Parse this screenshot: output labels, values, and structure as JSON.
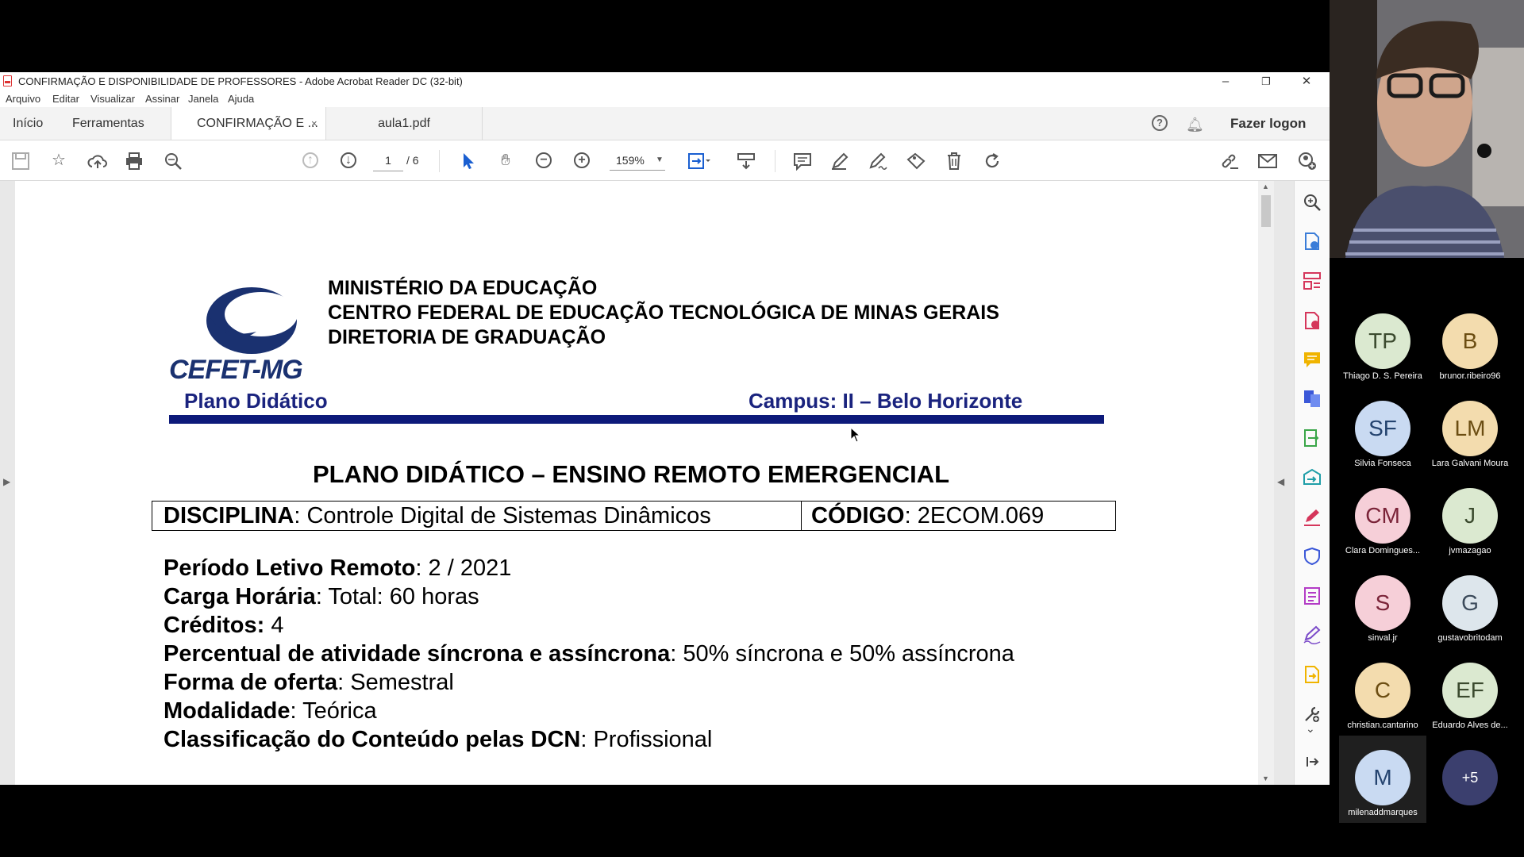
{
  "window": {
    "title": "CONFIRMAÇÃO E DISPONIBILIDADE DE PROFESSORES - Adobe Acrobat Reader DC (32-bit)",
    "controls": {
      "minimize": "–",
      "restore": "❐",
      "close": "✕"
    }
  },
  "menu": [
    "Arquivo",
    "Editar",
    "Visualizar",
    "Assinar",
    "Janela",
    "Ajuda"
  ],
  "tabs": {
    "home": "Início",
    "tools": "Ferramentas",
    "doc1": "CONFIRMAÇÃO E ...",
    "doc1_close": "×",
    "doc2": "aula1.pdf"
  },
  "header_right": {
    "login": "Fazer logon"
  },
  "toolbar": {
    "page_current": "1",
    "page_total": "/ 6",
    "zoom": "159%"
  },
  "document": {
    "ministry_lines": [
      "MINISTÉRIO DA EDUCAÇÃO",
      "CENTRO FEDERAL DE EDUCAÇÃO TECNOLÓGICA DE MINAS GERAIS",
      "DIRETORIA DE GRADUAÇÃO"
    ],
    "logo_text": "CEFET-MG",
    "plano": "Plano Didático",
    "campus": "Campus: II – Belo Horizonte",
    "heading": "PLANO DIDÁTICO – ENSINO REMOTO EMERGENCIAL",
    "disciplina": {
      "label": "DISCIPLINA",
      "value": ": Controle Digital de Sistemas Dinâmicos"
    },
    "codigo": {
      "label": "CÓDIGO",
      "value": ": 2ECOM.069"
    },
    "info": [
      {
        "label": "Período Letivo Remoto",
        "value": ": 2 / 2021"
      },
      {
        "label": "Carga Horária",
        "value": ": Total: 60 horas"
      },
      {
        "label": "Créditos:",
        "value": " 4"
      },
      {
        "label": "Percentual de atividade síncrona e assíncrona",
        "value": ": 50% síncrona e 50% assíncrona"
      },
      {
        "label": "Forma de oferta",
        "value": ": Semestral"
      },
      {
        "label": "Modalidade",
        "value": ": Teórica"
      },
      {
        "label": "Classificação do Conteúdo pelas DCN",
        "value": ": Profissional"
      }
    ]
  },
  "participants": [
    {
      "initials": "TP",
      "name": "Thiago D. S. Pereira",
      "color": "#dbe9d0",
      "text_color": "#3b4a2e"
    },
    {
      "initials": "B",
      "name": "brunor.ribeiro96",
      "color": "#f3dcae",
      "text_color": "#6b4d12"
    },
    {
      "initials": "SF",
      "name": "Silvia  Fonseca",
      "color": "#c9daf2",
      "text_color": "#24436f"
    },
    {
      "initials": "LM",
      "name": "Lara Galvani Moura",
      "color": "#f3dcae",
      "text_color": "#6b4d12"
    },
    {
      "initials": "CM",
      "name": "Clara Domingues...",
      "color": "#f6cfd8",
      "text_color": "#7a2338"
    },
    {
      "initials": "J",
      "name": "jvmazagao",
      "color": "#dbe9d0",
      "text_color": "#3b4a2e"
    },
    {
      "initials": "S",
      "name": "sinval.jr",
      "color": "#f6cfd8",
      "text_color": "#7a2338"
    },
    {
      "initials": "G",
      "name": "gustavobritodam",
      "color": "#dde6ec",
      "text_color": "#3b4a5a"
    },
    {
      "initials": "C",
      "name": "christian.cantarino",
      "color": "#f3dcae",
      "text_color": "#6b4d12"
    },
    {
      "initials": "EF",
      "name": "Eduardo Alves de...",
      "color": "#dbe9d0",
      "text_color": "#3b4a2e"
    },
    {
      "initials": "M",
      "name": "milenaddmarques",
      "color": "#c9daf2",
      "text_color": "#24436f"
    },
    {
      "initials": "+5",
      "name": "",
      "color": "#3b3f6e",
      "text_color": "#ffffff"
    }
  ]
}
